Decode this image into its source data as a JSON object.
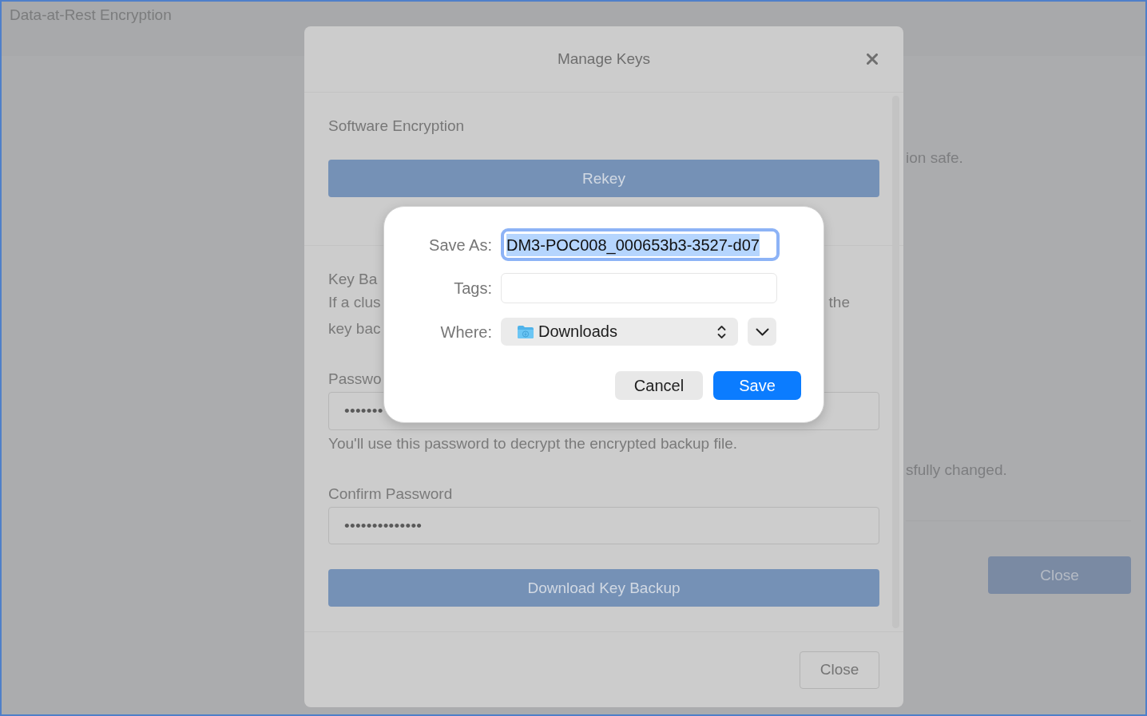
{
  "background_page": {
    "title": "Data-at-Rest Encryption",
    "texts": [
      "ion safe.",
      "sfully changed."
    ],
    "close_button": "Close"
  },
  "manage_keys_dialog": {
    "title": "Manage Keys",
    "software_encryption": {
      "heading": "Software Encryption",
      "rekey_button": "Rekey"
    },
    "key_backup": {
      "heading": "Key Ba",
      "lines": [
        {
          "left": "If a clus",
          "right": "the"
        },
        {
          "left": "key bac"
        }
      ],
      "password": {
        "label": "Passwo",
        "value": "•••••••",
        "hint": "You'll use this password to decrypt the encrypted backup file."
      },
      "confirm_password": {
        "label": "Confirm Password",
        "value": "••••••••••••••"
      },
      "download_button": "Download Key Backup"
    },
    "close_button": "Close"
  },
  "save_dialog": {
    "save_as": {
      "label": "Save As:",
      "value": "DM3-POC008_000653b3-3527-d07",
      "focused": true,
      "text_selected": true
    },
    "tags": {
      "label": "Tags:"
    },
    "where": {
      "label": "Where:",
      "value": "Downloads"
    },
    "buttons": [
      {
        "label": "Cancel",
        "kind": "secondary"
      },
      {
        "label": "Save",
        "kind": "primary"
      }
    ]
  }
}
